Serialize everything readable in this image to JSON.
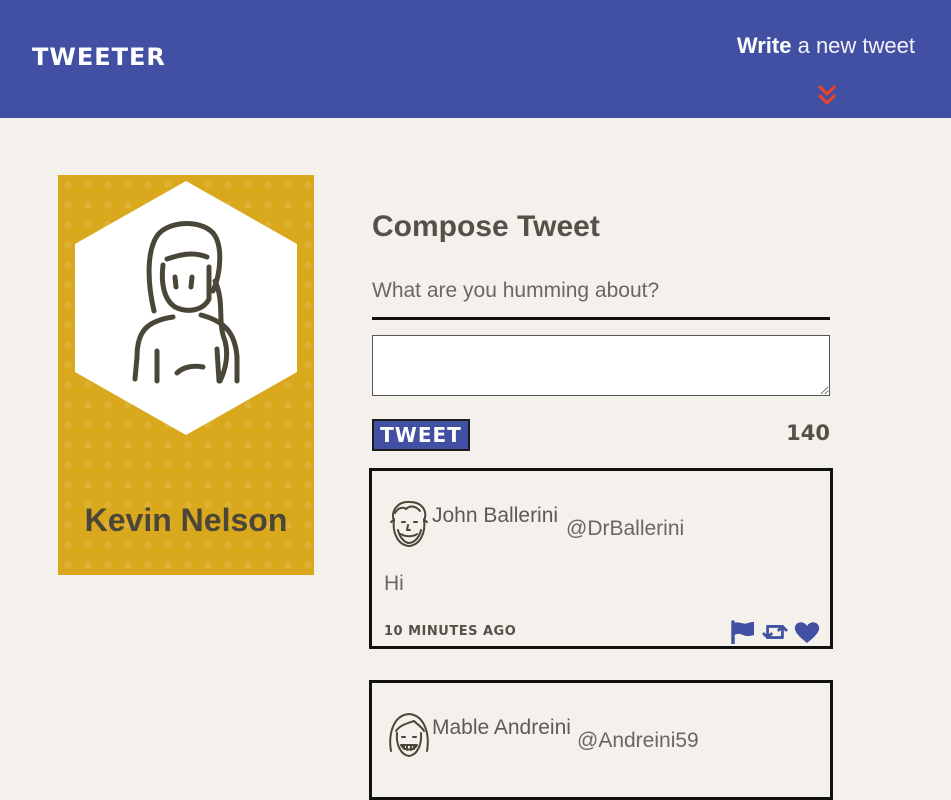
{
  "navbar": {
    "brand": "TWEETER",
    "write_bold": "Write",
    "write_rest": " a new tweet",
    "toggle_icon": "double-chevron-down-icon"
  },
  "profile": {
    "name": "Kevin Nelson",
    "avatar_icon": "person-avatar-icon"
  },
  "compose": {
    "title": "Compose Tweet",
    "label": "What are you humming about?",
    "textarea_value": "",
    "button_label": "TWEET",
    "counter": "140"
  },
  "tweets": [
    {
      "name": "John Ballerini",
      "handle": "@DrBallerini",
      "body": "Hi",
      "time": "10 MINUTES AGO",
      "actions": [
        "flag-icon",
        "retweet-icon",
        "heart-icon"
      ]
    },
    {
      "name": "Mable Andreini",
      "handle": "@Andreini59",
      "body": "",
      "time": "",
      "actions": []
    }
  ],
  "colors": {
    "navbar_bg": "#4250a3",
    "page_bg": "#f4f1ec",
    "profile_bg": "#d9a81c",
    "accent_red": "#e8432b",
    "action_blue": "#4250a3",
    "text": "#545149"
  }
}
